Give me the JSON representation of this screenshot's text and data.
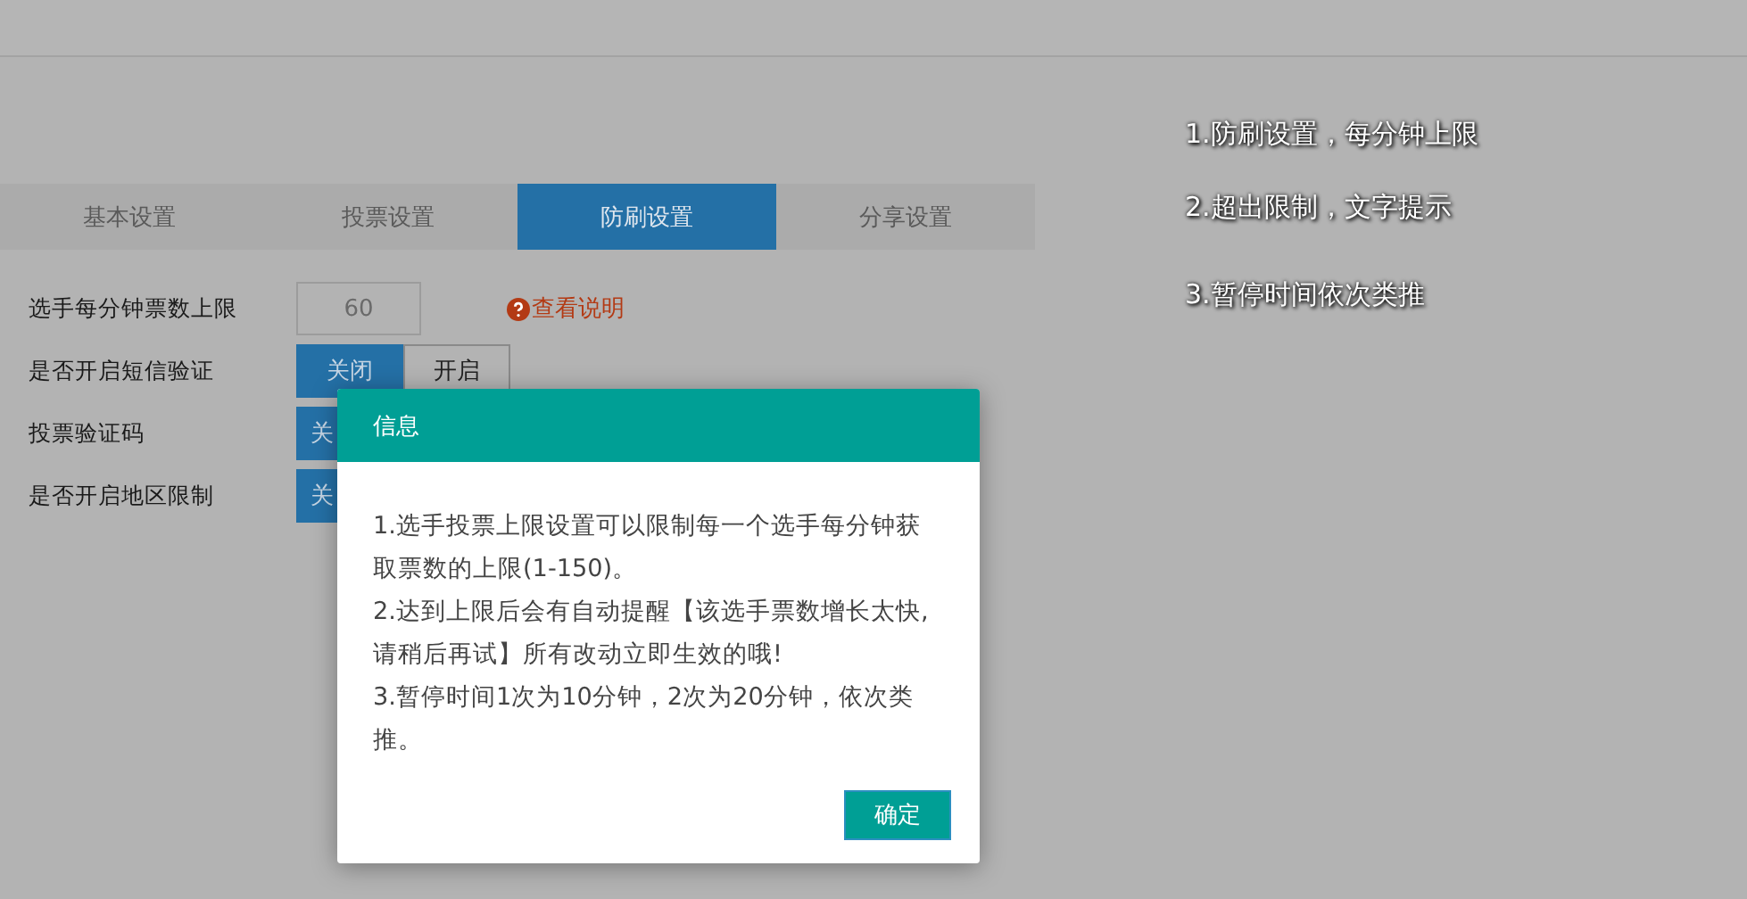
{
  "tabs": [
    {
      "label": "基本设置",
      "selected": false
    },
    {
      "label": "投票设置",
      "selected": false
    },
    {
      "label": "防刷设置",
      "selected": true
    },
    {
      "label": "分享设置",
      "selected": false
    }
  ],
  "form": [
    {
      "kind": "input",
      "label": "选手每分钟票数上限",
      "value": "60",
      "help": "查看说明"
    },
    {
      "kind": "toggle",
      "label": "是否开启短信验证",
      "options": [
        {
          "label": "关闭",
          "selected": true
        },
        {
          "label": "开启",
          "selected": false
        }
      ]
    },
    {
      "kind": "toggle",
      "label": "投票验证码",
      "options": [
        {
          "label": "关",
          "selected": true
        }
      ]
    },
    {
      "kind": "toggle",
      "label": "是否开启地区限制",
      "options": [
        {
          "label": "关",
          "selected": true
        }
      ]
    }
  ],
  "annotations": [
    "1.防刷设置，每分钟上限",
    "2.超出限制，文字提示",
    "3.暂停时间依次类推"
  ],
  "dialog": {
    "title": "信息",
    "lines": [
      "1.选手投票上限设置可以限制每一个选手每分钟获取票数的上限(1-150)。",
      "2.达到上限后会有自动提醒【该选手票数增长太快,请稍后再试】所有改动立即生效的哦!",
      "3.暂停时间1次为10分钟，2次为20分钟，依次类推。"
    ],
    "button": "确定"
  }
}
